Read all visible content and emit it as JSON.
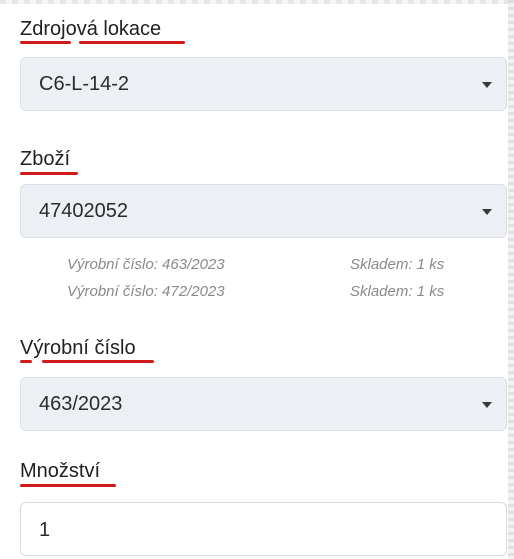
{
  "source_location": {
    "label": "Zdrojová lokace",
    "value": "C6-L-14-2"
  },
  "goods": {
    "label": "Zboží",
    "value": "47402052",
    "batches": [
      {
        "serial": "Výrobní číslo: 463/2023",
        "stock": "Skladem: 1 ks"
      },
      {
        "serial": "Výrobní číslo: 472/2023",
        "stock": "Skladem: 1 ks"
      }
    ]
  },
  "serial_number": {
    "label": "Výrobní číslo",
    "value": "463/2023"
  },
  "quantity": {
    "label": "Množství",
    "value": "1"
  },
  "colors": {
    "underline": "#d11a1a",
    "field_bg": "#eceff3"
  }
}
